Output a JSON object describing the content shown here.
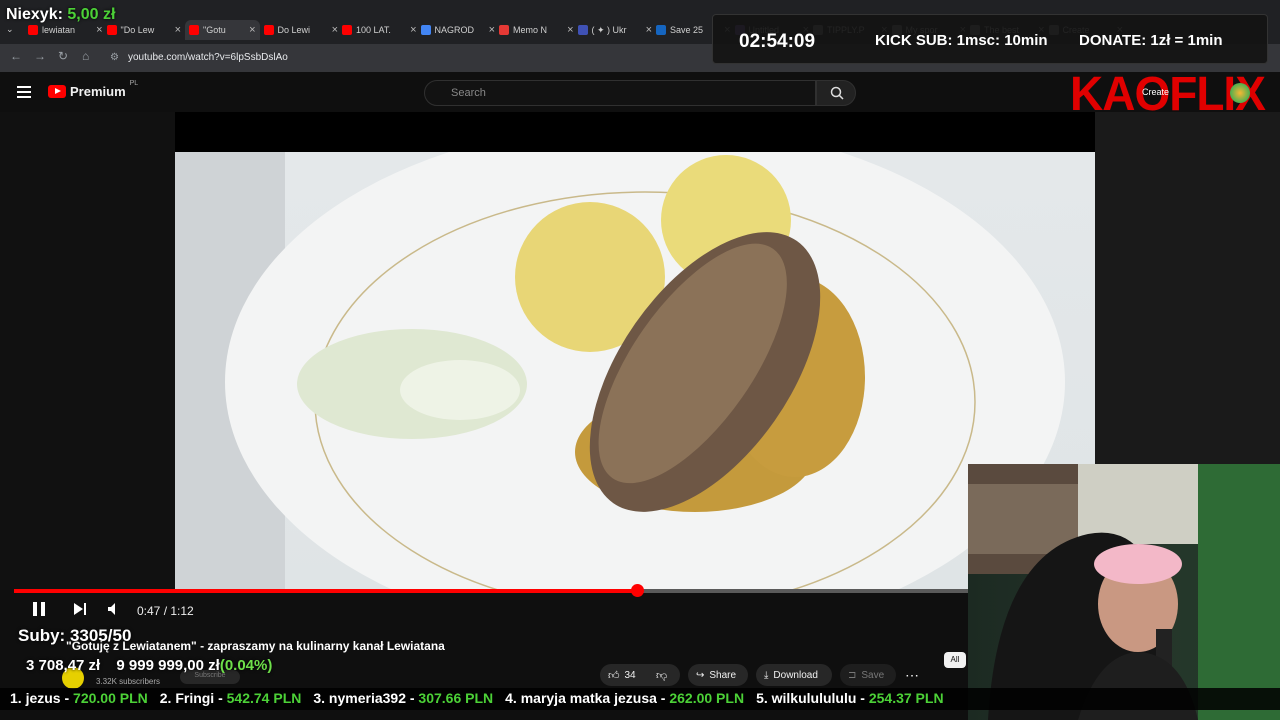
{
  "stream_overlay": {
    "donor_name": "Niexyk:",
    "donor_amount": "5,00 zł",
    "timer": "02:54:09",
    "kick_sub": "KICK SUB: 1msc: 10min",
    "donate_rate": "DONATE: 1zł = 1min",
    "brand": "KAOFLIX",
    "subs": "Suby: 3305/50",
    "goal_progress_text": "3 708,47 zł",
    "goal_target": "9 999 999,00 zł",
    "goal_percent": "(0.04%)"
  },
  "browser": {
    "tabs": [
      {
        "label": "lewiatan",
        "color": "#ff0000"
      },
      {
        "label": "\"Do Lew",
        "color": "#ff0000"
      },
      {
        "label": "\"Gotu",
        "color": "#ff0000"
      },
      {
        "label": "Do Lewi",
        "color": "#ff0000"
      },
      {
        "label": "100 LAT.",
        "color": "#ff0000"
      },
      {
        "label": "NAGROD",
        "color": "#4285f4"
      },
      {
        "label": "Memo N",
        "color": "#e53935"
      },
      {
        "label": "( ✦ ) Ukr",
        "color": "#3f51b5"
      },
      {
        "label": "Save 25",
        "color": "#1565c0"
      },
      {
        "label": "Untitled",
        "color": "#7e57c2"
      },
      {
        "label": "TIPPLY.P",
        "color": "#888888"
      },
      {
        "label": "My spor",
        "color": "#888888"
      },
      {
        "label": "The best",
        "color": "#888888"
      },
      {
        "label": "Create",
        "color": "#888888"
      }
    ],
    "url": "youtube.com/watch?v=6lpSsbDslAo"
  },
  "youtube": {
    "logo": "Premium",
    "logo_region": "PL",
    "search_placeholder": "Search",
    "create_label": "Create",
    "player": {
      "current_time": "0:47",
      "duration": "1:12",
      "progress_fraction": 0.6528
    },
    "video_title": "\"Gotuję z Lewiatanem\" - zapraszamy na kulinarny kanał Lewiatana",
    "channel_subscribers": "3.32K subscribers",
    "subscribe_label": "Subscribe",
    "like_count": "34",
    "share_label": "Share",
    "download_label": "Download",
    "save_label": "Save",
    "filter_label": "All"
  },
  "ticker": [
    {
      "name": "1. jezus - ",
      "amount": "720.00 PLN"
    },
    {
      "name": "2. Fringi - ",
      "amount": "542.74 PLN"
    },
    {
      "name": "3. nymeria392 - ",
      "amount": "307.66 PLN"
    },
    {
      "name": "4. maryja matka jezusa - ",
      "amount": "262.00 PLN"
    },
    {
      "name": "5. wilkululululu - ",
      "amount": "254.37 PLN"
    }
  ]
}
